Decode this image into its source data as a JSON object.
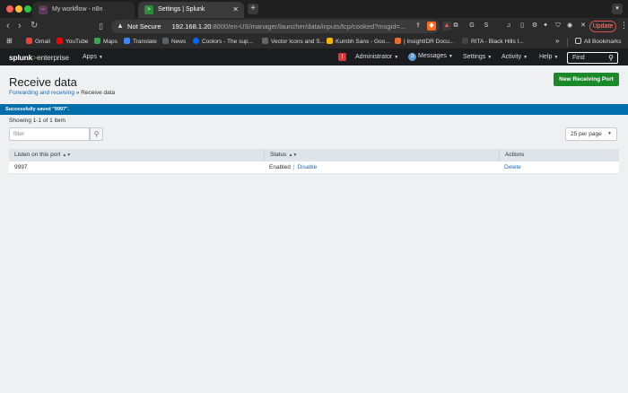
{
  "browser": {
    "tabs": [
      {
        "label": "My workflow - n8n",
        "favicon": "n8n-icon"
      },
      {
        "label": "Settings | Splunk",
        "favicon": "splunk-icon"
      }
    ],
    "address": {
      "security_label": "Not Secure",
      "host": "192.168.1.20",
      "path": ":8000/en-US/manager/launcher/data/inputs/tcp/cooked?msgid=..."
    },
    "update_label": "Update",
    "bookmarks": [
      {
        "label": "Gmail",
        "color": "#ea4335"
      },
      {
        "label": "YouTube",
        "color": "#ff0000"
      },
      {
        "label": "Maps",
        "color": "#34a853"
      },
      {
        "label": "Translate",
        "color": "#4285f4"
      },
      {
        "label": "News",
        "color": "#5f6368"
      },
      {
        "label": "Coolors - The sup...",
        "color": "#0066ff"
      },
      {
        "label": "Vector Icons and S...",
        "color": "#666666"
      },
      {
        "label": "Kumbh Sans - Goo...",
        "color": "#f4b400"
      },
      {
        "label": "| InsightIDR Docu...",
        "color": "#e8702a"
      },
      {
        "label": "RITA - Black Hills I...",
        "color": "#444444"
      }
    ],
    "all_bookmarks_label": "All Bookmarks"
  },
  "splunk": {
    "logo": {
      "main": "splunk",
      "gt": ">",
      "suffix": "enterprise"
    },
    "nav": {
      "apps": "Apps",
      "alert_count": "!",
      "administrator": "Administrator",
      "messages_count": "3",
      "messages": "Messages",
      "settings": "Settings",
      "activity": "Activity",
      "help": "Help",
      "find_placeholder": "Find"
    }
  },
  "page": {
    "title": "Receive data",
    "breadcrumb": {
      "parent": "Forwarding and receiving",
      "separator": "»",
      "current": "Receive data"
    },
    "new_button": "New Receiving Port",
    "success_message": "Successfully saved \"9997\".",
    "showing": "Showing 1-1 of 1 item",
    "filter_placeholder": "filter",
    "per_page": "25 per page"
  },
  "table": {
    "headers": {
      "port": "Listen on this port",
      "status": "Status",
      "actions": "Actions"
    },
    "rows": [
      {
        "port": "9997",
        "status": "Enabled",
        "toggle": "Disable",
        "action": "Delete"
      }
    ]
  }
}
